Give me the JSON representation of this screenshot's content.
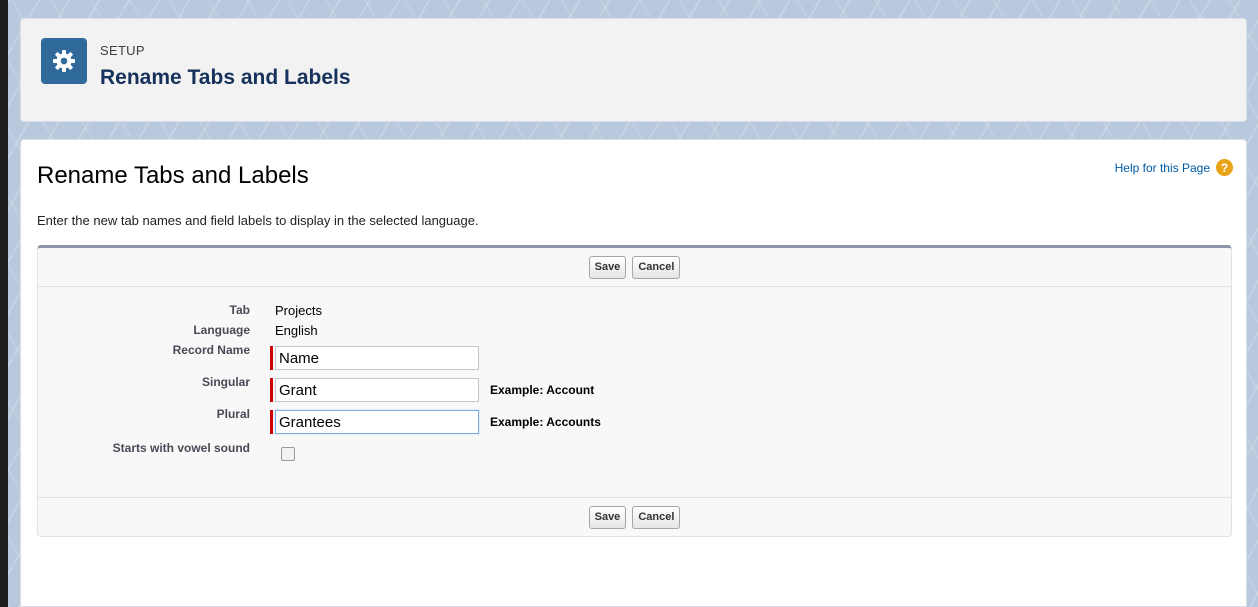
{
  "header": {
    "eyebrow": "SETUP",
    "title": "Rename Tabs and Labels",
    "icon": "gear-icon"
  },
  "page": {
    "title": "Rename Tabs and Labels",
    "help_link": "Help for this Page",
    "help_icon": "?",
    "instructions": "Enter the new tab names and field labels to display in the selected language."
  },
  "buttons": {
    "save": "Save",
    "cancel": "Cancel"
  },
  "form": {
    "tab": {
      "label": "Tab",
      "value": "Projects"
    },
    "language": {
      "label": "Language",
      "value": "English"
    },
    "record_name": {
      "label": "Record Name",
      "value": "Name"
    },
    "singular": {
      "label": "Singular",
      "value": "Grant",
      "example": "Example: Account"
    },
    "plural": {
      "label": "Plural",
      "value": "Grantees",
      "example": "Example: Accounts"
    },
    "vowel": {
      "label": "Starts with vowel sound",
      "checked": false
    }
  },
  "colors": {
    "header_icon_bg": "#2f6a9a",
    "required_bar": "#cc0000",
    "help_icon": "#e8a417",
    "link": "#015ba7"
  }
}
